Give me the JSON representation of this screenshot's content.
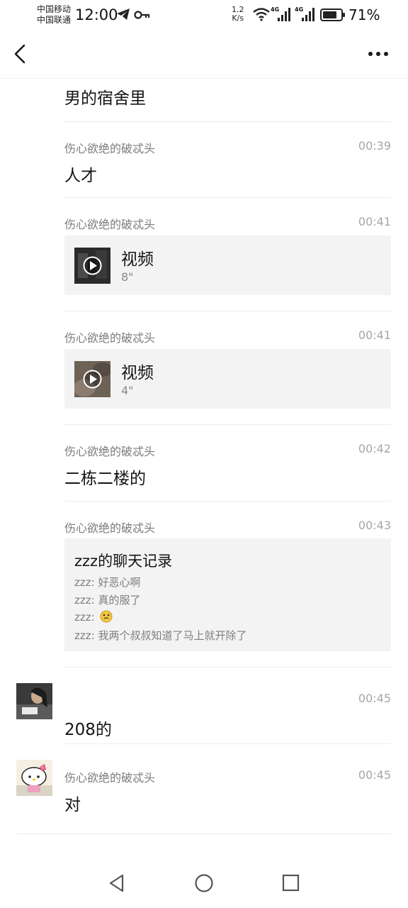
{
  "status_bar": {
    "carrier_1": "中国移动",
    "carrier_2": "中国联通",
    "time": "12:00",
    "speed_value": "1.2",
    "speed_unit": "K/s",
    "battery_percent": "71%",
    "network_label_1": "4G",
    "network_label_2": "4G",
    "icons": [
      "telegram-icon",
      "key-icon",
      "wifi-icon",
      "signal-icon",
      "battery-icon"
    ]
  },
  "title_bar": {
    "back_icon": "chevron-left-icon",
    "more_icon": "more-dots-icon"
  },
  "messages": [
    {
      "type": "text",
      "sender": "",
      "time": "",
      "text": "男的宿舍里"
    },
    {
      "type": "text",
      "sender": "伤心欲绝的破忒头",
      "time": "00:39",
      "text": "人才"
    },
    {
      "type": "video",
      "sender": "伤心欲绝的破忒头",
      "time": "00:41",
      "title": "视频",
      "duration": "8\""
    },
    {
      "type": "video",
      "sender": "伤心欲绝的破忒头",
      "time": "00:41",
      "title": "视频",
      "duration": "4\""
    },
    {
      "type": "text",
      "sender": "伤心欲绝的破忒头",
      "time": "00:42",
      "text": "二栋二楼的"
    },
    {
      "type": "chat_record",
      "sender": "伤心欲绝的破忒头",
      "time": "00:43",
      "title": "zzz的聊天记录",
      "lines": [
        "zzz: 好恶心啊",
        "zzz: 真的服了",
        "zzz:",
        "zzz: 我两个叔叔知道了马上就开除了"
      ]
    },
    {
      "type": "text",
      "sender": "",
      "time": "00:45",
      "text": "208的"
    },
    {
      "type": "text",
      "sender": "伤心欲绝的破忒头",
      "time": "00:45",
      "text": "对"
    }
  ],
  "nav_bar": {
    "back_icon": "nav-back-triangle-icon",
    "home_icon": "nav-home-circle-icon",
    "recents_icon": "nav-recents-square-icon"
  },
  "colors": {
    "background": "#ffffff",
    "card": "#f3f3f3",
    "sender": "#7c7c7c",
    "time": "#a6a6a6"
  }
}
